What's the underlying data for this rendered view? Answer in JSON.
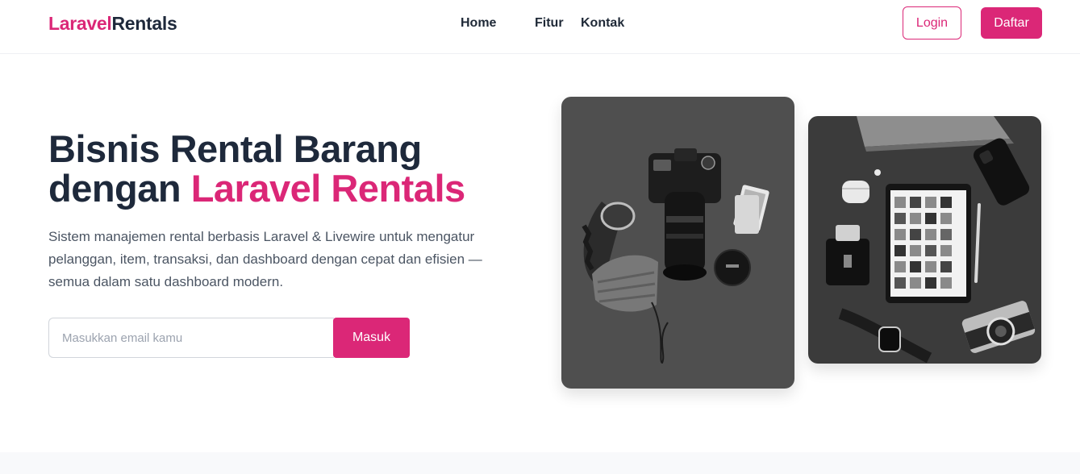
{
  "brand": {
    "part1": "Laravel",
    "part2": "Rentals"
  },
  "nav": {
    "home": "Home",
    "features": "Fitur",
    "contact": "Kontak"
  },
  "auth": {
    "login": "Login",
    "register": "Daftar"
  },
  "hero": {
    "title_line1": "Bisnis Rental Barang",
    "title_prefix": "dengan ",
    "title_accent": "Laravel Rentals",
    "description": "Sistem manajemen rental berbasis Laravel & Livewire untuk mengatur pelanggan, item, transaksi, dan dashboard dengan cepat dan efisien — semua dalam satu dashboard modern."
  },
  "signup": {
    "placeholder": "Masukkan email kamu",
    "button": "Masuk"
  },
  "colors": {
    "accent": "#db2777",
    "heading": "#1e293b",
    "body_text": "#4b5563"
  }
}
